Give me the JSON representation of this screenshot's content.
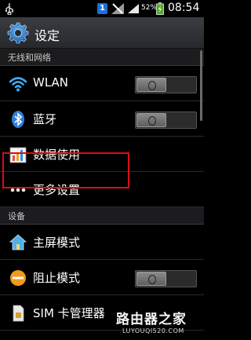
{
  "status_bar": {
    "notification_count": "1",
    "battery_percent": "52%",
    "time": "08:54",
    "icons": [
      "usb-icon",
      "notification-icon",
      "no-signal-icon",
      "signal-icon",
      "battery-charging-icon"
    ]
  },
  "header": {
    "title": "设定",
    "icon": "settings-gear-icon"
  },
  "sections": [
    {
      "title": "无线和网络"
    },
    {
      "title": "设备"
    }
  ],
  "rows": {
    "wlan": {
      "label": "WLAN",
      "icon": "wifi-icon",
      "toggle": "off"
    },
    "bluetooth": {
      "label": "蓝牙",
      "icon": "bluetooth-icon",
      "toggle": "off"
    },
    "data_usage": {
      "label": "数据使用",
      "icon": "bar-chart-icon"
    },
    "more_settings": {
      "label": "更多设置",
      "icon": "more-dots-icon"
    },
    "home_mode": {
      "label": "主屏模式",
      "icon": "home-icon"
    },
    "block_mode": {
      "label": "阻止模式",
      "icon": "block-icon",
      "toggle": "off"
    },
    "sim_manager": {
      "label": "SIM 卡管理器",
      "icon": "sim-card-icon"
    }
  },
  "watermark": {
    "text": "路由器之家",
    "url": "LUYOUQI520.COM"
  },
  "colors": {
    "highlight": "#d80f0f",
    "wifi": "#3fa9f5",
    "bluetooth": "#2f7fd8",
    "block": "#f39a1e"
  }
}
